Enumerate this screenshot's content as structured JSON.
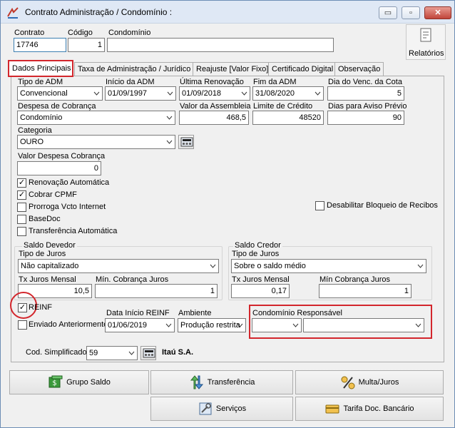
{
  "window": {
    "title": "Contrato Administração / Condomínio :",
    "minimize": "▭",
    "maximize": "▫",
    "close": "✕"
  },
  "header": {
    "contrato_label": "Contrato",
    "contrato_value": "17746",
    "codigo_label": "Código",
    "codigo_value": "1",
    "condominio_label": "Condomínio",
    "condominio_value": "",
    "relatorios_label": "Relatórios"
  },
  "tabs": [
    {
      "label": "Dados Principais"
    },
    {
      "label": "Taxa de Administração / Jurídico"
    },
    {
      "label": "Reajuste [Valor Fixo]"
    },
    {
      "label": "Certificado Digital"
    },
    {
      "label": "Observação"
    }
  ],
  "form": {
    "tipo_adm_label": "Tipo de ADM",
    "tipo_adm_value": "Convencional",
    "inicio_adm_label": "Início da ADM",
    "inicio_adm_value": "01/09/1997",
    "ultima_renov_label": "Última Renovação",
    "ultima_renov_value": "01/09/2018",
    "fim_adm_label": "Fim da ADM",
    "fim_adm_value": "31/08/2020",
    "dia_venc_label": "Dia do Venc. da Cota",
    "dia_venc_value": "5",
    "despesa_cobranca_label": "Despesa de Cobrança",
    "despesa_cobranca_value": "Condomínio",
    "valor_assembleia_label": "Valor da Assembleia",
    "valor_assembleia_value": "468,5",
    "limite_credito_label": "Limite de Crédito",
    "limite_credito_value": "48520",
    "dias_aviso_label": "Dias para Aviso Prévio",
    "dias_aviso_value": "90",
    "categoria_label": "Categoria",
    "categoria_value": "OURO",
    "valor_despesa_label": "Valor Despesa Cobrança",
    "valor_despesa_value": "0",
    "chk_renovacao": "Renovação Automática",
    "chk_cpmf": "Cobrar CPMF",
    "chk_prorroga": "Prorroga Vcto Internet",
    "chk_basedoc": "BaseDoc",
    "chk_transferencia": "Transferência Automática",
    "chk_desabilitar": "Desabilitar Bloqueio de Recibos"
  },
  "saldo_devedor": {
    "title": "Saldo Devedor",
    "tipo_juros_label": "Tipo de Juros",
    "tipo_juros_value": "Não capitalizado",
    "tx_juros_label": "Tx Juros Mensal",
    "tx_juros_value": "10,5",
    "min_cobranca_label": "Mín. Cobrança Juros",
    "min_cobranca_value": "1"
  },
  "saldo_credor": {
    "title": "Saldo Credor",
    "tipo_juros_label": "Tipo de Juros",
    "tipo_juros_value": "Sobre o saldo médio",
    "tx_juros_label": "Tx Juros Mensal",
    "tx_juros_value": "0,17",
    "min_cobranca_label": "Mín Cobrança Juros",
    "min_cobranca_value": "1"
  },
  "reinf": {
    "reinf_label": "REINF",
    "enviado_label": "Enviado Anteriormente",
    "data_inicio_label": "Data Início REINF",
    "data_inicio_value": "01/06/2019",
    "ambiente_label": "Ambiente",
    "ambiente_value": "Produção restrita",
    "condominio_resp_label": "Condomínio Responsável",
    "condominio_resp_code": "",
    "condominio_resp_name": ""
  },
  "cod_simplificado": {
    "label": "Cod. Simplificado",
    "value": "59",
    "bank": "Itaú S.A."
  },
  "buttons": {
    "grupo_saldo": "Grupo Saldo",
    "transferencia": "Transferência",
    "multa_juros": "Multa/Juros",
    "servicos": "Serviços",
    "tarifa": "Tarifa Doc. Bancário"
  },
  "colors": {
    "highlight": "#d3262c",
    "titlebar": "#dfe8f5"
  }
}
